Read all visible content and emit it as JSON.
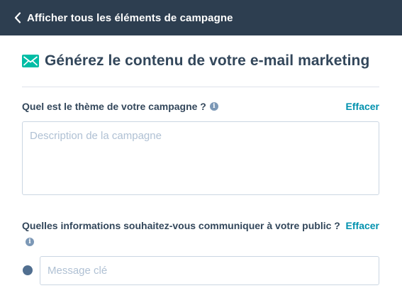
{
  "topbar": {
    "back_label": "Afficher tous les éléments de campagne",
    "icon": "chevron-left-icon"
  },
  "header": {
    "title": "Générez le contenu de votre e-mail marketing",
    "icon": "email-icon",
    "icon_color": "#00bda5"
  },
  "theme_field": {
    "label": "Quel est le thème de votre campagne ?",
    "clear_label": "Effacer",
    "placeholder": "Description de la campagne",
    "value": ""
  },
  "info_field": {
    "label": "Quelles informations souhaitez-vous communiquer à votre public ?",
    "clear_label": "Effacer",
    "message_placeholder": "Message clé",
    "message_value": ""
  },
  "colors": {
    "topbar_bg": "#2d3e50",
    "text": "#33475b",
    "link": "#0091ae",
    "placeholder": "#b0c1d4",
    "border": "#cbd6e2"
  }
}
